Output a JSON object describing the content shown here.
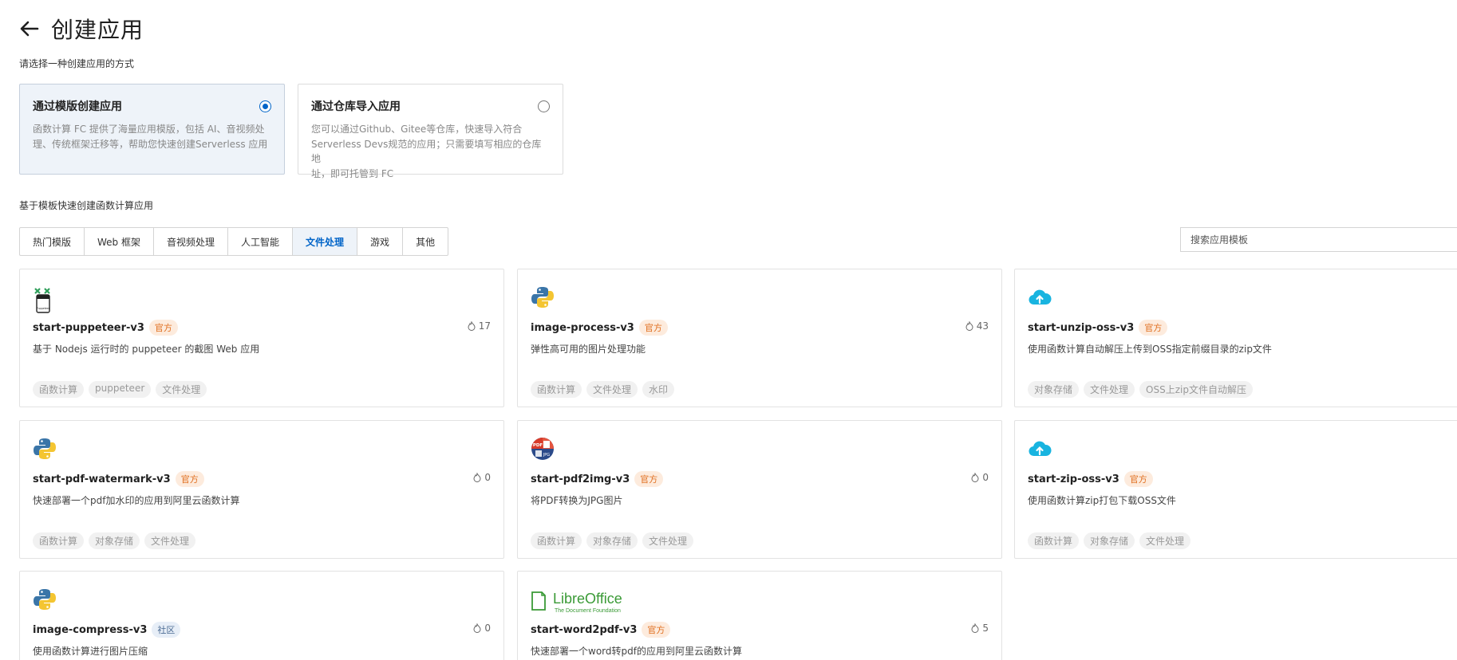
{
  "page": {
    "title": "创建应用",
    "subtitle": "请选择一种创建应用的方式",
    "section_label": "基于模板快速创建函数计算应用"
  },
  "methods": [
    {
      "title": "通过模版创建应用",
      "desc_line1": "函数计算 FC 提供了海量应用模版，包括 AI、音视频处",
      "desc_line2": "理、传统框架迁移等，帮助您快速创建Serverless 应用",
      "selected": true
    },
    {
      "title": "通过仓库导入应用",
      "desc_line1": "您可以通过Github、Gitee等仓库，快速导入符合",
      "desc_line2": "Serverless Devs规范的应用；只需要填写相应的仓库地",
      "desc_line3": "址，即可托管到 FC",
      "selected": false
    }
  ],
  "tabs": [
    "热门模版",
    "Web 框架",
    "音视频处理",
    "人工智能",
    "文件处理",
    "游戏",
    "其他"
  ],
  "active_tab": "文件处理",
  "search": {
    "placeholder": "搜索应用模板"
  },
  "cards": [
    {
      "name": "start-puppeteer-v3",
      "badge": "官方",
      "likes": "17",
      "desc": "基于 Nodejs 运行时的 puppeteer 的截图 Web 应用",
      "tags": [
        "函数计算",
        "puppeteer",
        "文件处理"
      ],
      "icon": "puppeteer-logo-icon",
      "logo_text": "Puppeteer"
    },
    {
      "name": "image-process-v3",
      "badge": "官方",
      "likes": "43",
      "desc": "弹性高可用的图片处理功能",
      "tags": [
        "函数计算",
        "文件处理",
        "水印"
      ],
      "icon": "python-logo-icon"
    },
    {
      "name": "start-unzip-oss-v3",
      "badge": "官方",
      "likes": "",
      "desc": "使用函数计算自动解压上传到OSS指定前缀目录的zip文件",
      "tags": [
        "对象存储",
        "文件处理",
        "OSS上zip文件自动解压"
      ],
      "icon": "cloud-upload-icon"
    },
    {
      "name": "start-pdf-watermark-v3",
      "badge": "官方",
      "likes": "0",
      "desc": "快速部署一个pdf加水印的应用到阿里云函数计算",
      "tags": [
        "函数计算",
        "对象存储",
        "文件处理"
      ],
      "icon": "python-logo-icon"
    },
    {
      "name": "start-pdf2img-v3",
      "badge": "官方",
      "likes": "0",
      "desc": "将PDF转换为JPG图片",
      "tags": [
        "函数计算",
        "对象存储",
        "文件处理"
      ],
      "icon": "pdf-to-jpg-icon",
      "logo_text": "PDF",
      "logo_text2": "JPG"
    },
    {
      "name": "start-zip-oss-v3",
      "badge": "官方",
      "likes": "",
      "desc": "使用函数计算zip打包下载OSS文件",
      "tags": [
        "函数计算",
        "对象存储",
        "文件处理"
      ],
      "icon": "cloud-upload-icon"
    },
    {
      "name": "image-compress-v3",
      "badge": "社区",
      "likes": "0",
      "desc": "使用函数计算进行图片压缩",
      "tags": [],
      "icon": "python-logo-icon"
    },
    {
      "name": "start-word2pdf-v3",
      "badge": "官方",
      "likes": "5",
      "desc": "快速部署一个word转pdf的应用到阿里云函数计算",
      "tags": [],
      "icon": "libreoffice-logo-icon",
      "logo_text": "LibreOffice",
      "logo_subtext": "The Document Foundation"
    }
  ],
  "colors": {
    "primary": "#0064c8",
    "official_badge_bg": "#fdebdd",
    "official_badge_text": "#e06f1f",
    "selected_bg": "#eef3f9"
  }
}
